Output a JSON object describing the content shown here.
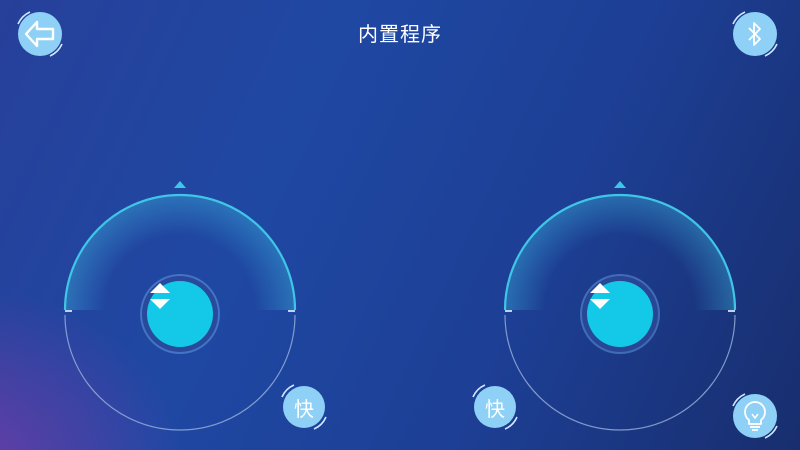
{
  "header": {
    "title": "内置程序",
    "back_icon": "back-arrow-icon",
    "bluetooth_icon": "bluetooth-icon"
  },
  "joysticks": {
    "left": {
      "speed_label": "快",
      "knob_icon": "up-down-arrows-icon"
    },
    "right": {
      "speed_label": "快",
      "knob_icon": "up-down-arrows-icon"
    }
  },
  "footer": {
    "light_icon": "lightbulb-icon"
  },
  "colors": {
    "accent": "#14c8e8",
    "button_fill": "#8fd0f6",
    "arc": "#3fc6e6"
  }
}
